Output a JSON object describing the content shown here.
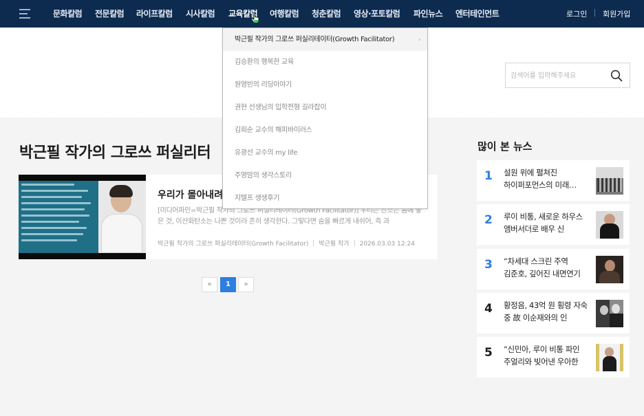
{
  "nav": {
    "items": [
      {
        "label": "문화칼럼"
      },
      {
        "label": "전문칼럼"
      },
      {
        "label": "라이프칼럼"
      },
      {
        "label": "시사칼럼"
      },
      {
        "label": "교육칼럼"
      },
      {
        "label": "여행칼럼"
      },
      {
        "label": "청춘칼럼"
      },
      {
        "label": "영상·포토칼럼"
      },
      {
        "label": "파인뉴스"
      },
      {
        "label": "엔터테인먼트"
      }
    ],
    "active": "교육칼럼",
    "login": "로그인",
    "signup": "회원가입"
  },
  "search": {
    "placeholder": "검색어를 입력해주세요",
    "icon": "search-icon"
  },
  "dropdown": {
    "items": [
      {
        "label": "박근필 작가의 그로쓰 퍼실리테이터(Growth Facilitator)",
        "arrow": "›"
      },
      {
        "label": "김승환의 행복한 교육"
      },
      {
        "label": "원영빈의 리딩이야기"
      },
      {
        "label": "권현 선생님의 입학전형 길라잡이"
      },
      {
        "label": "김희순 교수의 해피바이러스"
      },
      {
        "label": "유광선 교수의 my life"
      },
      {
        "label": "주영맘의 생각스토리"
      },
      {
        "label": "지텔프 생생후기"
      }
    ]
  },
  "page": {
    "title": "박근필 작가의 그로쓰 퍼실리터"
  },
  "article": {
    "title": "우리가 몰아내려",
    "summary": "[미디어파인=박근필 작가의 그로쓰 퍼실리테이터(Growth Facilitator)] 우리는 산소는 몸에 좋은 것, 이산화탄소는 나쁜 것이라 흔히 생각한다. 그렇다면 숨을 빠르게 내쉬어, 즉 과",
    "section": "박근필 작가의 그로쓰 퍼실리테이터(Growth Facilitator)",
    "author": "박근필 작가",
    "date": "2026.03.03 12:24"
  },
  "pagination": {
    "prev": "«",
    "current": "1",
    "next": "»"
  },
  "popular": {
    "heading": "많이 본 뉴스",
    "items": [
      {
        "rank": "1",
        "text": "설원 위에 펼쳐진 하이퍼포먼스의 미래… 몽클"
      },
      {
        "rank": "2",
        "text": "루이 비통, 새로운 하우스 앰버서더로 배우 신"
      },
      {
        "rank": "3",
        "text": "“차세대 스크린 주역 김준호, 깊어진 내면연기"
      },
      {
        "rank": "4",
        "text": "황정음, 43억 원 횡령 자숙 중 故 이순재와의 인"
      },
      {
        "rank": "5",
        "text": "“신민아, 루이 비통 파인 주얼리와 빚어낸 우아한"
      }
    ]
  },
  "colors": {
    "nav_bg": "#0d2a4f",
    "rank_blue": "#2d7ee0",
    "rank_dark": "#1c1c1c",
    "accent": "#2d7ee0"
  }
}
